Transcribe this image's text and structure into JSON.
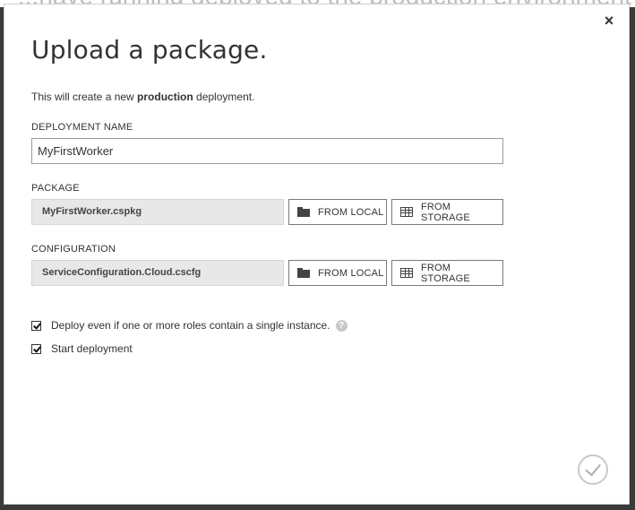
{
  "background": {
    "text": "...have running deployed to the production environment"
  },
  "dialog": {
    "title": "Upload a package.",
    "description": {
      "prefix": "This will create a new ",
      "emphasis": "production",
      "suffix": " deployment."
    },
    "close_label": "×",
    "deployment_name": {
      "label": "DEPLOYMENT NAME",
      "value": "MyFirstWorker"
    },
    "package": {
      "label": "PACKAGE",
      "file": "MyFirstWorker.cspkg",
      "from_local": "FROM LOCAL",
      "from_storage": "FROM STORAGE"
    },
    "configuration": {
      "label": "CONFIGURATION",
      "file": "ServiceConfiguration.Cloud.cscfg",
      "from_local": "FROM LOCAL",
      "from_storage": "FROM STORAGE"
    },
    "options": {
      "deploy_single_instance": {
        "label": "Deploy even if one or more roles contain a single instance.",
        "checked": true
      },
      "start_deployment": {
        "label": "Start deployment",
        "checked": true
      }
    },
    "help_glyph": "?"
  },
  "icons": {
    "close": "close-icon",
    "local": "folder-icon",
    "storage": "table-icon",
    "help": "question-icon",
    "confirm": "checkmark-icon"
  }
}
